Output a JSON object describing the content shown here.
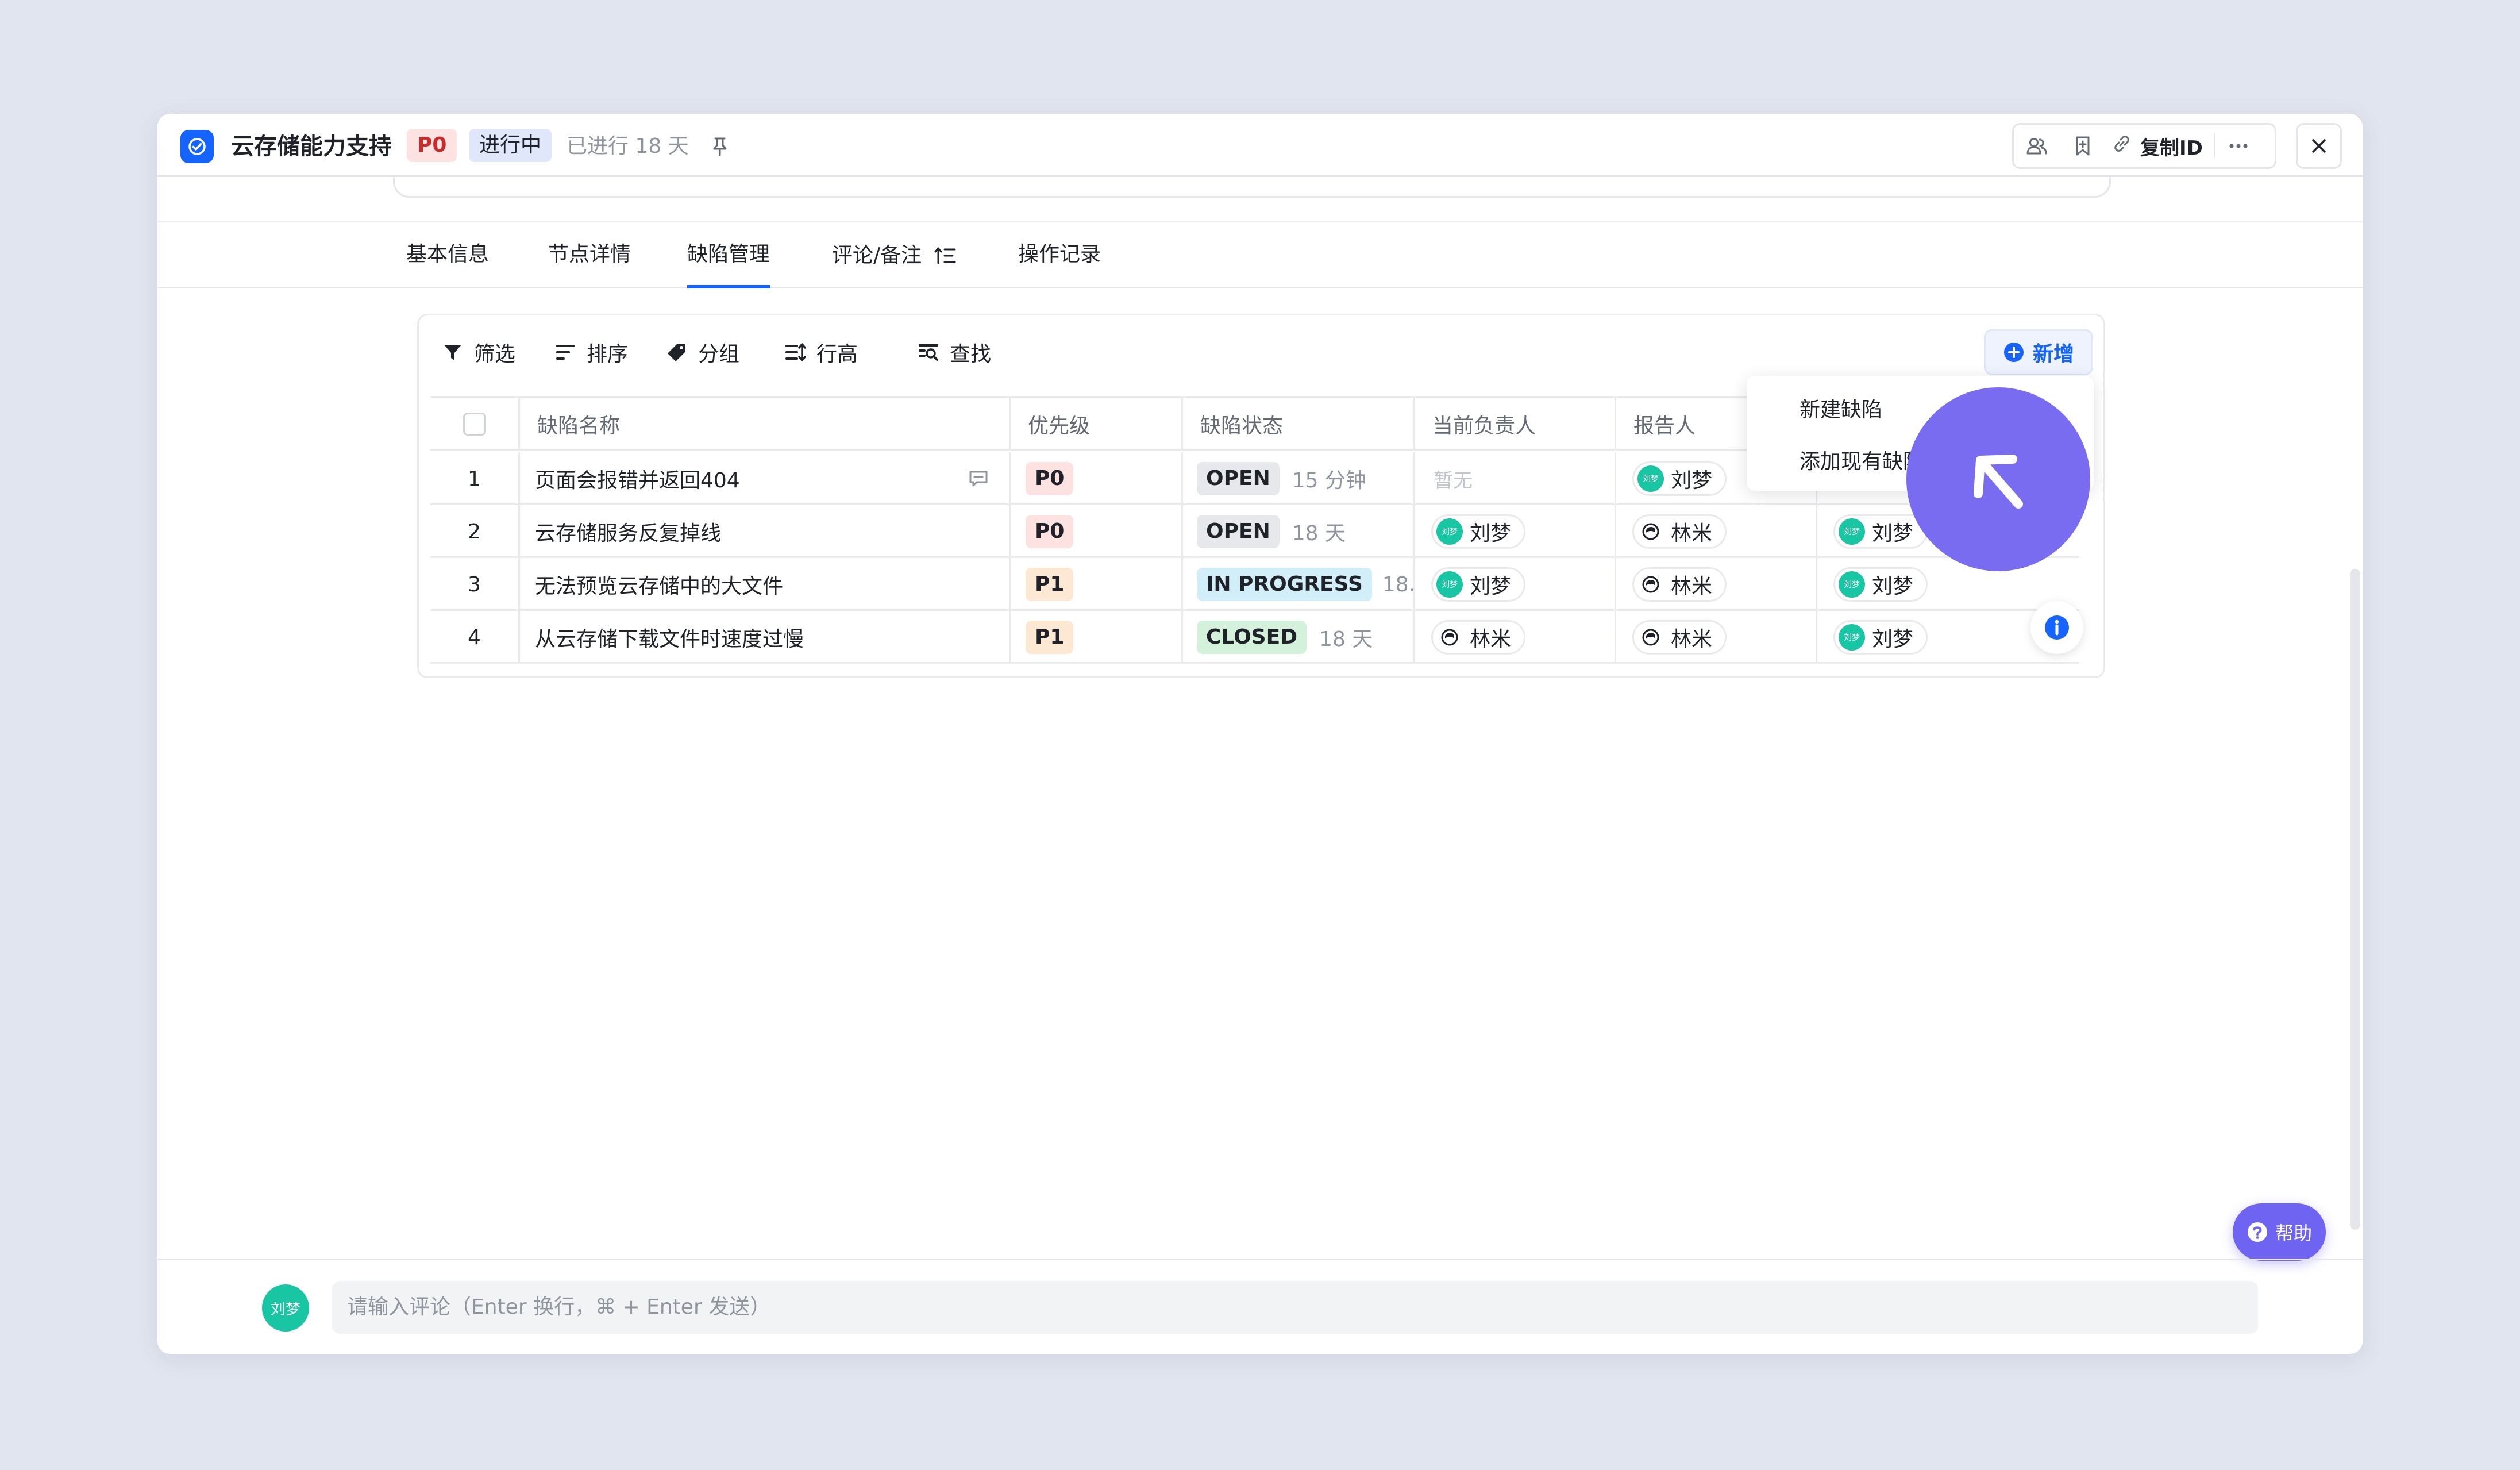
{
  "header": {
    "title": "云存储能力支持",
    "priority": "P0",
    "status": "进行中",
    "elapsed": "已进行 18 天",
    "copy_id_label": "复制ID"
  },
  "tabs": [
    {
      "label": "基本信息"
    },
    {
      "label": "节点详情"
    },
    {
      "label": "缺陷管理"
    },
    {
      "label": "评论/备注"
    },
    {
      "label": "操作记录"
    }
  ],
  "toolbar": {
    "filter": "筛选",
    "sort": "排序",
    "group": "分组",
    "row_height": "行高",
    "find": "查找",
    "add": "新增"
  },
  "columns": {
    "name": "缺陷名称",
    "priority": "优先级",
    "status": "缺陷状态",
    "assignee": "当前负责人",
    "reporter": "报告人"
  },
  "rows": [
    {
      "index": "1",
      "name": "页面会报错并返回404",
      "priority": "P0",
      "status": "OPEN",
      "time": "15 分钟",
      "assignee": "",
      "assignee_placeholder": "暂无",
      "reporter": "刘梦",
      "extra": ""
    },
    {
      "index": "2",
      "name": "云存储服务反复掉线",
      "priority": "P0",
      "status": "OPEN",
      "time": "18 天",
      "assignee": "刘梦",
      "assignee_placeholder": "",
      "reporter": "林米",
      "extra": "刘梦"
    },
    {
      "index": "3",
      "name": "无法预览云存储中的大文件",
      "priority": "P1",
      "status": "IN PROGRESS",
      "time": "18...",
      "assignee": "刘梦",
      "assignee_placeholder": "",
      "reporter": "林米",
      "extra": "刘梦"
    },
    {
      "index": "4",
      "name": "从云存储下载文件时速度过慢",
      "priority": "P1",
      "status": "CLOSED",
      "time": "18 天",
      "assignee": "林米",
      "assignee_placeholder": "",
      "reporter": "林米",
      "extra": "刘梦"
    }
  ],
  "avatar_text": "刘梦",
  "dropdown": {
    "new_defect": "新建缺陷",
    "add_existing": "添加现有缺陷"
  },
  "help_label": "帮助",
  "comment": {
    "avatar": "刘梦",
    "placeholder": "请输入评论（Enter 换行，⌘ + Enter 发送）"
  },
  "colors": {
    "accent": "#1664ff",
    "cursor": "#7a6cf0",
    "help": "#6f63f2",
    "avatar": "#18c6a3"
  }
}
